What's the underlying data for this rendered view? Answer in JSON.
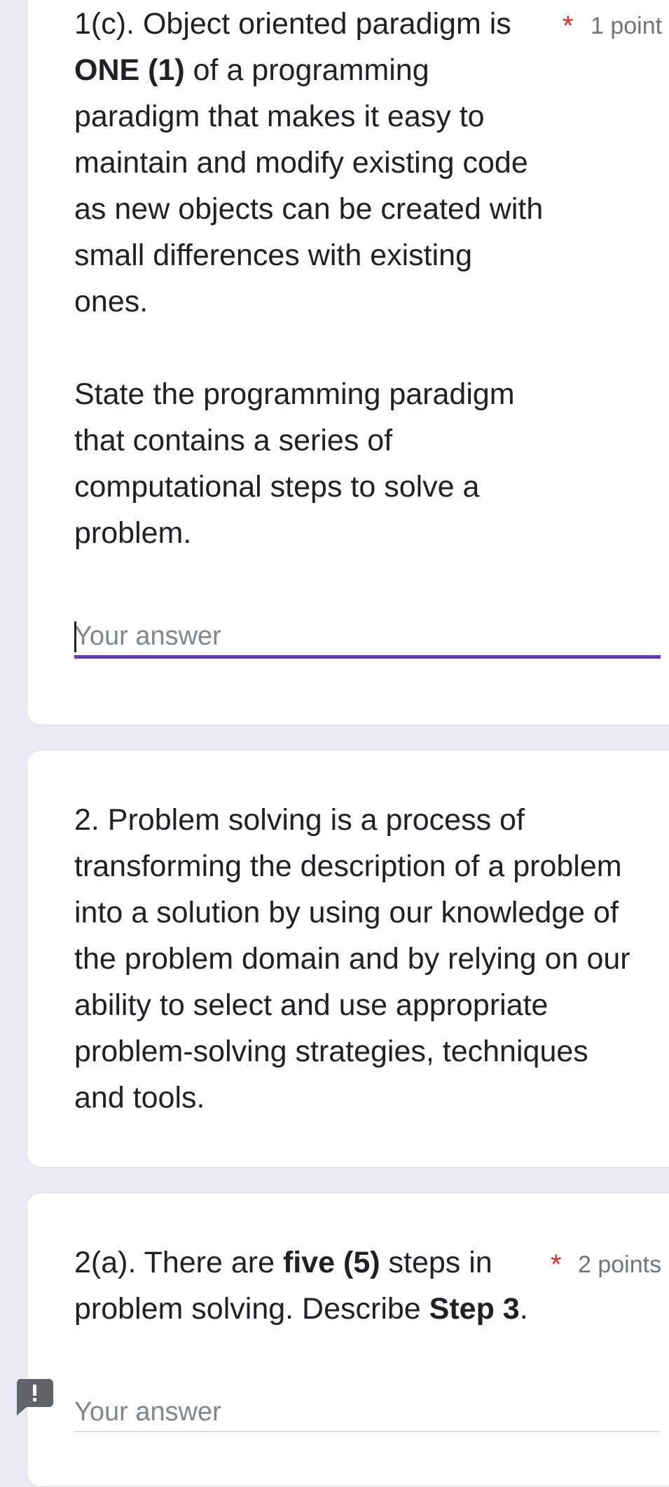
{
  "questions": [
    {
      "number_prefix": "1(c). ",
      "line1": "Object oriented paradigm is",
      "bold_one": "ONE (1)",
      "line2_rest": " of a programming",
      "line3": "paradigm that makes it easy to",
      "line4": "maintain and modify existing code",
      "line5": "as new objects can be created with",
      "line6": "small differences with existing",
      "line7": "ones.",
      "line8": "State the programming paradigm",
      "line9": "that contains a series of",
      "line10": "computational steps to solve a",
      "line11": "problem.",
      "required": "*",
      "points": "1 point",
      "answer_placeholder": "Your answer"
    },
    {
      "line1": "2. Problem solving is a process of",
      "line2": "transforming the description of a problem",
      "line3": "into a solution by using our knowledge of",
      "line4": "the problem domain and by relying on our",
      "line5": "ability to select and use appropriate",
      "line6": "problem-solving strategies, techniques",
      "line7": "and tools."
    },
    {
      "line1_a": "2(a). There are ",
      "bold_five": "five (5)",
      "line1_b": " steps in",
      "line2_a": "problem solving. Describe ",
      "bold_step": "Step 3",
      "line2_b": ".",
      "required": "*",
      "points": "2 points",
      "answer_placeholder": "Your answer"
    }
  ],
  "colors": {
    "background": "#ece9f7",
    "accent": "#673ab7",
    "required": "#d93025"
  },
  "icons": {
    "report": "report-problem-icon"
  }
}
